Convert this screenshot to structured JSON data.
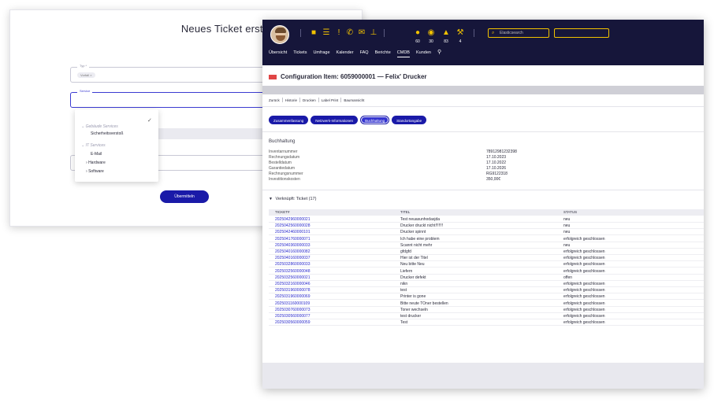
{
  "back_form": {
    "title": "Neues Ticket erstellen",
    "typ_label": "Typ *",
    "typ_chip": "Vorfall ×",
    "service_label": "Service",
    "dropdown": {
      "group1": "Gebäude Services",
      "item1": "Sicherheitsverstoß",
      "group2": "IT Services",
      "item2": "E-Mail",
      "item3": "Hardware",
      "item4": "Software"
    },
    "submit_label": "Übermitteln"
  },
  "topbar": {
    "counts": [
      "60",
      "30",
      "83",
      "4"
    ],
    "search_placeholder": "Elasticsearch",
    "nav": [
      "Übersicht",
      "Tickets",
      "Umfrage",
      "Kalender",
      "FAQ",
      "Berichte",
      "CMDB",
      "Kunden"
    ],
    "active_nav": "CMDB",
    "accent_color": "#f2c200",
    "bar_color": "#16163a"
  },
  "ci": {
    "title": "Configuration Item: 6059000001 — Felix' Drucker",
    "actions": [
      "Zurück",
      "Historie",
      "Drucken",
      "Label Print",
      "Baumansicht"
    ],
    "tabs": [
      "Zusammenfassung",
      "Netzwerk-Informationen",
      "Buchhaltung",
      "Standortangabe"
    ],
    "active_tab": "Buchhaltung"
  },
  "buchhaltung": {
    "title": "Buchhaltung",
    "rows": [
      {
        "label": "Inventarnummer",
        "value": "78912981232398"
      },
      {
        "label": "Rechnungsdatum",
        "value": "17.10.2023"
      },
      {
        "label": "Bestelldatum",
        "value": "17.10.2022"
      },
      {
        "label": "Garantiedatum",
        "value": "17.10.2026"
      },
      {
        "label": "Rechnungsnummer",
        "value": "RG9122318"
      },
      {
        "label": "Investitionskosten",
        "value": "350,00€"
      }
    ]
  },
  "tickets": {
    "heading": "Verknüpft: Ticket (17)",
    "columns": [
      "TICKET#",
      "TITEL",
      "STATUS"
    ],
    "rows": [
      [
        "2025042960000021",
        "Test neuasunhodasjda",
        "neu"
      ],
      [
        "2025042560000028",
        "Drucker druckt nicht!!!!!!!",
        "neu"
      ],
      [
        "2025042460000101",
        "Drucker spinnt",
        "neu"
      ],
      [
        "2025041760000071",
        "Ich habe eine problem",
        "erfolgreich geschlossen"
      ],
      [
        "2025040360000033",
        "Scannt nicht mehr",
        "neu"
      ],
      [
        "2025040160000082",
        "gfdgfd",
        "erfolgreich geschlossen"
      ],
      [
        "2025040160000037",
        "Hier ist der Titel",
        "erfolgreich geschlossen"
      ],
      [
        "2025032860000033",
        "Neu bitte Neu",
        "erfolgreich geschlossen"
      ],
      [
        "2025032560000048",
        "Liefern",
        "erfolgreich geschlossen"
      ],
      [
        "2025032560000021",
        "Drucker defekt",
        "offen"
      ],
      [
        "2025032160000046",
        "nikn",
        "erfolgreich geschlossen"
      ],
      [
        "2025031960000078",
        "test",
        "erfolgreich geschlossen"
      ],
      [
        "2025031960000069",
        "Printer is gone",
        "erfolgreich geschlossen"
      ],
      [
        "2025031160000109",
        "Bitte neute TOner bestellen",
        "erfolgreich geschlossen"
      ],
      [
        "2025030760000073",
        "Toner wechseln",
        "erfolgreich geschlossen"
      ],
      [
        "2025030560000077",
        "test drucker",
        "erfolgreich geschlossen"
      ],
      [
        "2025030560000059",
        "Test",
        "erfolgreich geschlossen"
      ]
    ]
  }
}
